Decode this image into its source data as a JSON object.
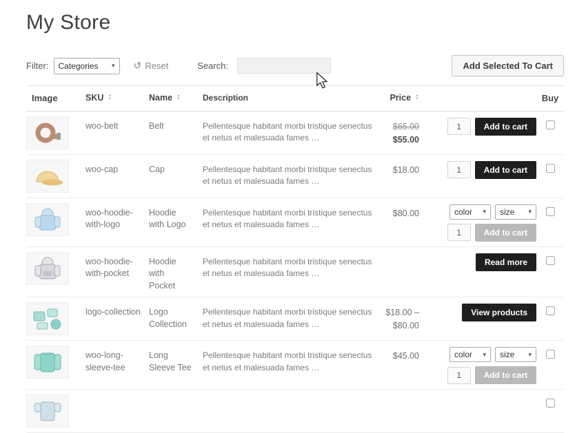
{
  "page": {
    "title": "My Store"
  },
  "toolbar": {
    "filter_label": "Filter:",
    "category_select_value": "Categories",
    "reset_label": "Reset",
    "search_label": "Search:",
    "search_value": "",
    "add_selected_button": "Add Selected To Cart"
  },
  "icons": {
    "select_arrow": "▾",
    "sort_asc": "▲",
    "sort_desc": "▼",
    "reset_icon": "↺"
  },
  "table": {
    "headers": {
      "image": "Image",
      "sku": "SKU",
      "name": "Name",
      "description": "Description",
      "price": "Price",
      "buy": "Buy"
    },
    "rows": [
      {
        "sku": "woo-belt",
        "name": "Belt",
        "description": "Pellentesque habitant morbi tristique senectus et netus et malesuada fames …",
        "price_old": "$65.00",
        "price": "$55.00",
        "qty": "1",
        "button": "Add to cart"
      },
      {
        "sku": "woo-cap",
        "name": "Cap",
        "description": "Pellentesque habitant morbi tristique senectus et netus et malesuada fames …",
        "price": "$18.00",
        "qty": "1",
        "button": "Add to cart"
      },
      {
        "sku": "woo-hoodie-with-logo",
        "name": "Hoodie with Logo",
        "description": "Pellentesque habitant morbi tristique senectus et netus et malesuada fames …",
        "price": "$80.00",
        "color_option": "color",
        "size_option": "size",
        "qty": "1",
        "button": "Add to cart"
      },
      {
        "sku": "woo-hoodie-with-pocket",
        "name": "Hoodie with Pocket",
        "description": "Pellentesque habitant morbi tristique senectus et netus et malesuada fames …",
        "price": "",
        "button": "Read more"
      },
      {
        "sku": "logo-collection",
        "name": "Logo Collection",
        "description": "Pellentesque habitant morbi tristique senectus et netus et malesuada fames …",
        "price": "$18.00 – $80.00",
        "button": "View products"
      },
      {
        "sku": "woo-long-sleeve-tee",
        "name": "Long Sleeve Tee",
        "description": "Pellentesque habitant morbi tristique senectus et netus et malesuada fames …",
        "price": "$45.00",
        "color_option": "color",
        "size_option": "size",
        "qty": "1",
        "button": "Add to cart"
      }
    ]
  },
  "colors": {
    "button_dark": "#1f1f1f",
    "button_disabled": "#b9b9b9",
    "sale_price": "#4a4a4a",
    "muted_text": "#777777"
  }
}
